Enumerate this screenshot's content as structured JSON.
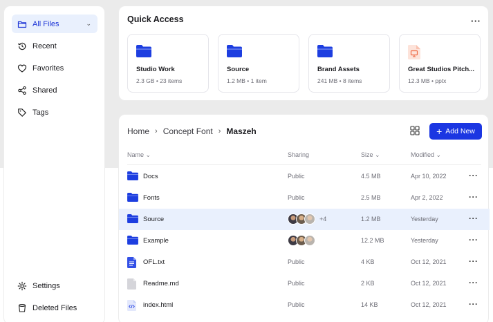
{
  "sidebar": {
    "items": [
      {
        "label": "All Files",
        "icon": "folder-icon",
        "active": true
      },
      {
        "label": "Recent",
        "icon": "history-icon"
      },
      {
        "label": "Favorites",
        "icon": "heart-icon"
      },
      {
        "label": "Shared",
        "icon": "share-icon"
      },
      {
        "label": "Tags",
        "icon": "tag-icon"
      }
    ],
    "bottom_items": [
      {
        "label": "Settings",
        "icon": "gear-icon"
      },
      {
        "label": "Deleted Files",
        "icon": "trash-icon"
      }
    ]
  },
  "quick_access": {
    "title": "Quick Access",
    "cards": [
      {
        "name": "Studio Work",
        "size": "2.3 GB",
        "detail": "23 items",
        "icon": "folder-icon"
      },
      {
        "name": "Source",
        "size": "1.2 MB",
        "detail": "1 item",
        "icon": "folder-icon"
      },
      {
        "name": "Brand Assets",
        "size": "241 MB",
        "detail": "8 items",
        "icon": "folder-icon"
      },
      {
        "name": "Great Studios Pitch...",
        "size": "12.3 MB",
        "detail": "pptx",
        "icon": "presentation-file-icon"
      }
    ]
  },
  "breadcrumb": {
    "items": [
      "Home",
      "Concept Font"
    ],
    "current": "Maszeh"
  },
  "toolbar": {
    "new_label": "Add New"
  },
  "table": {
    "headers": {
      "name": "Name",
      "sharing": "Sharing",
      "size": "Size",
      "modified": "Modified"
    },
    "rows": [
      {
        "name": "Docs",
        "type": "folder",
        "sharing": "Public",
        "size": "4.5 MB",
        "modified": "Apr 10, 2022"
      },
      {
        "name": "Fonts",
        "type": "folder",
        "sharing": "Public",
        "size": "2.5 MB",
        "modified": "Apr 2, 2022"
      },
      {
        "name": "Source",
        "type": "folder",
        "sharing_avatars": 3,
        "sharing_extra": "+4",
        "size": "1.2 MB",
        "modified": "Yesterday",
        "selected": true
      },
      {
        "name": "Example",
        "type": "folder",
        "sharing_avatars": 3,
        "size": "12.2 MB",
        "modified": "Yesterday"
      },
      {
        "name": "OFL.txt",
        "type": "text",
        "sharing": "Public",
        "size": "4 KB",
        "modified": "Oct 12, 2021"
      },
      {
        "name": "Readme.md",
        "type": "markdown",
        "sharing": "Public",
        "size": "2 KB",
        "modified": "Oct 12, 2021"
      },
      {
        "name": "index.html",
        "type": "code",
        "sharing": "Public",
        "size": "14 KB",
        "modified": "Oct 12, 2021"
      }
    ]
  },
  "colors": {
    "accent": "#1b36e2",
    "active_bg": "#e9f0fd",
    "folder": "#1d3ee0"
  }
}
